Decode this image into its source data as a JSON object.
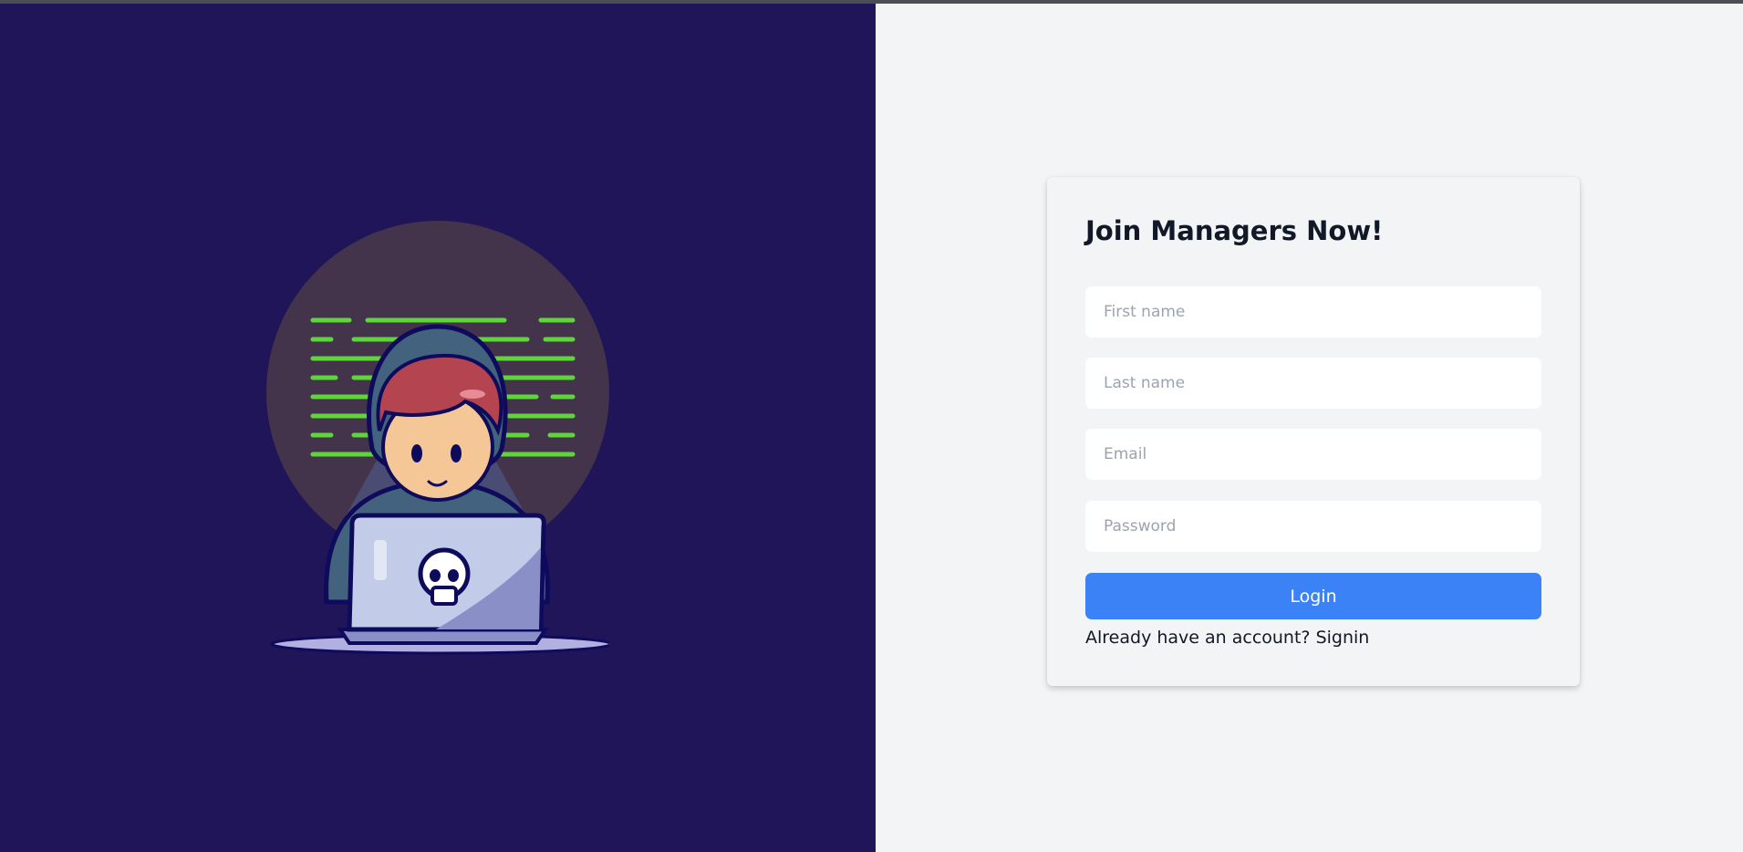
{
  "form": {
    "title": "Join Managers Now!",
    "fields": {
      "first_name": {
        "placeholder": "First name",
        "value": ""
      },
      "last_name": {
        "placeholder": "Last name",
        "value": ""
      },
      "email": {
        "placeholder": "Email",
        "value": ""
      },
      "password": {
        "placeholder": "Password",
        "value": ""
      }
    },
    "submit_label": "Login",
    "account_prompt": "Already have an account?",
    "signin_label": "Signin"
  },
  "illustration": {
    "icon": "hacker-laptop-illustration"
  },
  "colors": {
    "left_panel_bg": "#21155a",
    "right_panel_bg": "#f3f4f6",
    "button_bg": "#3b82f6",
    "code_lines": "#5ed63b"
  }
}
